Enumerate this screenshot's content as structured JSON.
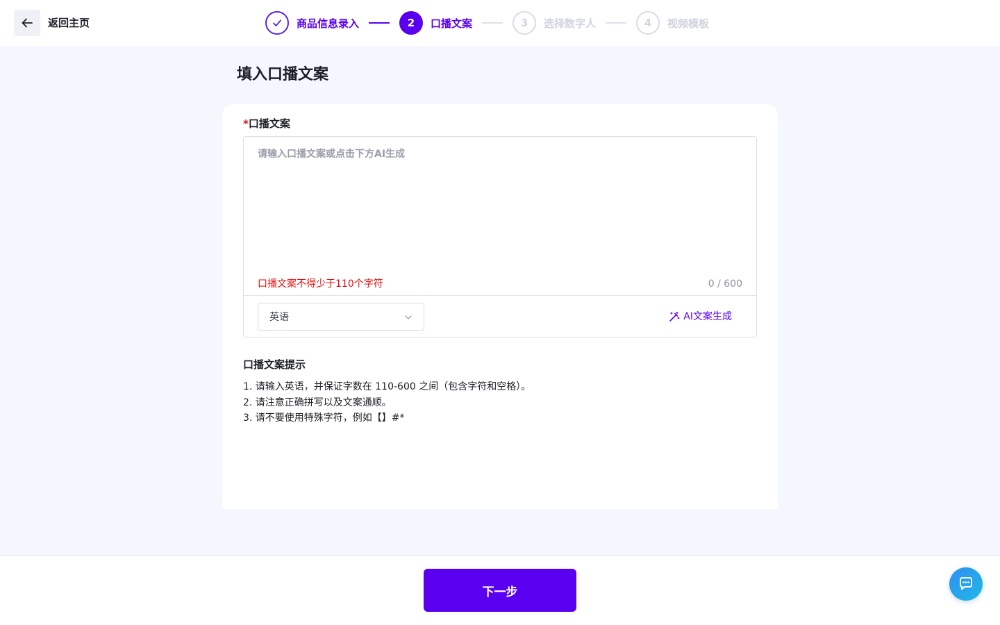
{
  "header": {
    "back_label": "返回主页",
    "steps": [
      {
        "number": "1",
        "label": "商品信息录入",
        "state": "done"
      },
      {
        "number": "2",
        "label": "口播文案",
        "state": "active"
      },
      {
        "number": "3",
        "label": "选择数字人",
        "state": "pending"
      },
      {
        "number": "4",
        "label": "视频模板",
        "state": "pending"
      }
    ]
  },
  "main": {
    "title": "填入口播文案",
    "field": {
      "required_mark": "*",
      "label": "口播文案",
      "value": "",
      "placeholder": "请输入口播文案或点击下方AI生成",
      "error": "口播文案不得少于110个字符",
      "counter": "0 / 600"
    },
    "language_select": {
      "selected": "英语"
    },
    "ai_button_label": "AI文案生成",
    "tips": {
      "title": "口播文案提示",
      "items": [
        "1. 请输入英语，并保证字数在 110-600 之间（包含字符和空格）。",
        "2. 请注意正确拼写以及文案通顺。",
        "3. 请不要使用特殊字符，例如【】#*"
      ]
    }
  },
  "footer": {
    "next_label": "下一步"
  },
  "colors": {
    "brand": "#5a00f0",
    "error": "#e50c0c",
    "chat_fab": "#2f8ff0"
  },
  "icons": {
    "back": "arrow-left-icon",
    "step_done": "check-icon",
    "select": "chevron-down-icon",
    "ai": "magic-wand-icon",
    "chat": "chat-bubble-icon"
  }
}
